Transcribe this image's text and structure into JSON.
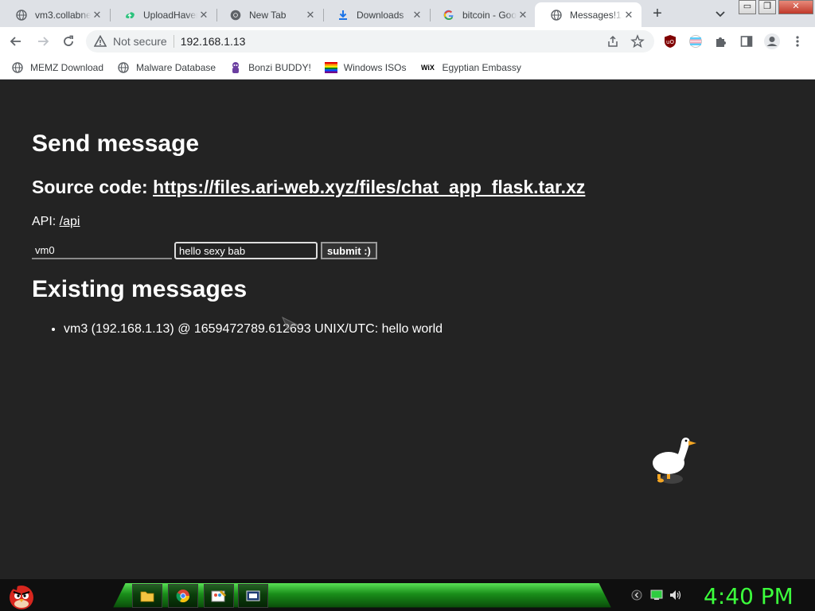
{
  "browser": {
    "tabs": [
      {
        "title": "vm3.collabne",
        "icon": "globe-icon"
      },
      {
        "title": "UploadHaven",
        "icon": "uploadhaven-icon"
      },
      {
        "title": "New Tab",
        "icon": "chrome-icon"
      },
      {
        "title": "Downloads",
        "icon": "download-icon"
      },
      {
        "title": "bitcoin - Goo",
        "icon": "google-icon"
      },
      {
        "title": "Messages!11",
        "icon": "globe-icon",
        "active": true
      }
    ],
    "new_tab_symbol": "+",
    "close_symbol": "✕",
    "window_controls": {
      "minimize": "▭",
      "restore": "❐",
      "close": "✕"
    }
  },
  "toolbar": {
    "security_label": "Not secure",
    "url": "192.168.1.13"
  },
  "bookmarks": [
    {
      "label": "MEMZ Download",
      "icon": "globe-icon"
    },
    {
      "label": "Malware Database",
      "icon": "globe-icon"
    },
    {
      "label": "Bonzi BUDDY!",
      "icon": "bonzi-icon"
    },
    {
      "label": "Windows ISOs",
      "icon": "windows-flag-icon"
    },
    {
      "label": "Egyptian Embassy",
      "icon": "wix-icon",
      "badge": "WiX"
    }
  ],
  "page": {
    "heading": "Send message",
    "source_label": "Source code: ",
    "source_link": "https://files.ari-web.xyz/files/chat_app_flask.tar.xz",
    "api_label": "API: ",
    "api_link": "/api",
    "name_value": "vm0",
    "message_value": "hello sexy bab",
    "submit_label": "submit :)",
    "existing_heading": "Existing messages",
    "messages": [
      {
        "text": "vm3 (192.168.1.13) @ 1659472789.612693 UNIX/UTC: hello world"
      }
    ]
  },
  "taskbar": {
    "clock": "4:40 PM",
    "apps": [
      "file-explorer-icon",
      "chrome-icon",
      "paint-icon",
      "media-icon"
    ]
  },
  "colors": {
    "page_bg": "#232323",
    "taskbar_green": "#3cff3c",
    "tab_strip": "#dee1e6"
  }
}
